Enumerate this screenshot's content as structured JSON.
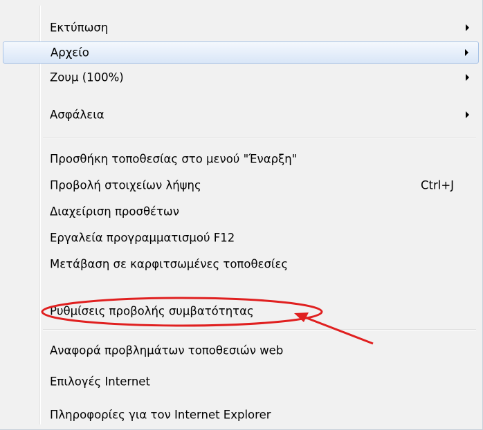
{
  "menu": {
    "group1": [
      {
        "label": "Εκτύπωση",
        "submenu": true
      },
      {
        "label": "Αρχείο",
        "submenu": true,
        "highlighted": true
      },
      {
        "label": "Ζουμ (100%)",
        "submenu": true
      },
      {
        "label": "Ασφάλεια",
        "submenu": true
      }
    ],
    "group2": [
      {
        "label": "Προσθήκη τοποθεσίας στο μενού \"Έναρξη\""
      },
      {
        "label": "Προβολή στοιχείων λήψης",
        "shortcut": "Ctrl+J"
      },
      {
        "label": "Διαχείριση προσθέτων"
      },
      {
        "label": "Εργαλεία προγραμματισμού F12"
      },
      {
        "label": "Μετάβαση σε καρφιτσωμένες τοποθεσίες"
      },
      {
        "label": "Ρυθμίσεις προβολής συμβατότητας"
      }
    ],
    "group3": [
      {
        "label": "Αναφορά προβλημάτων τοποθεσιών web"
      },
      {
        "label": "Επιλογές Internet"
      },
      {
        "label": "Πληροφορίες για τον Internet Explorer"
      }
    ]
  },
  "annotation": {
    "color": "#e02020",
    "circled_item": "Ρυθμίσεις προβολής συμβατότητας"
  }
}
